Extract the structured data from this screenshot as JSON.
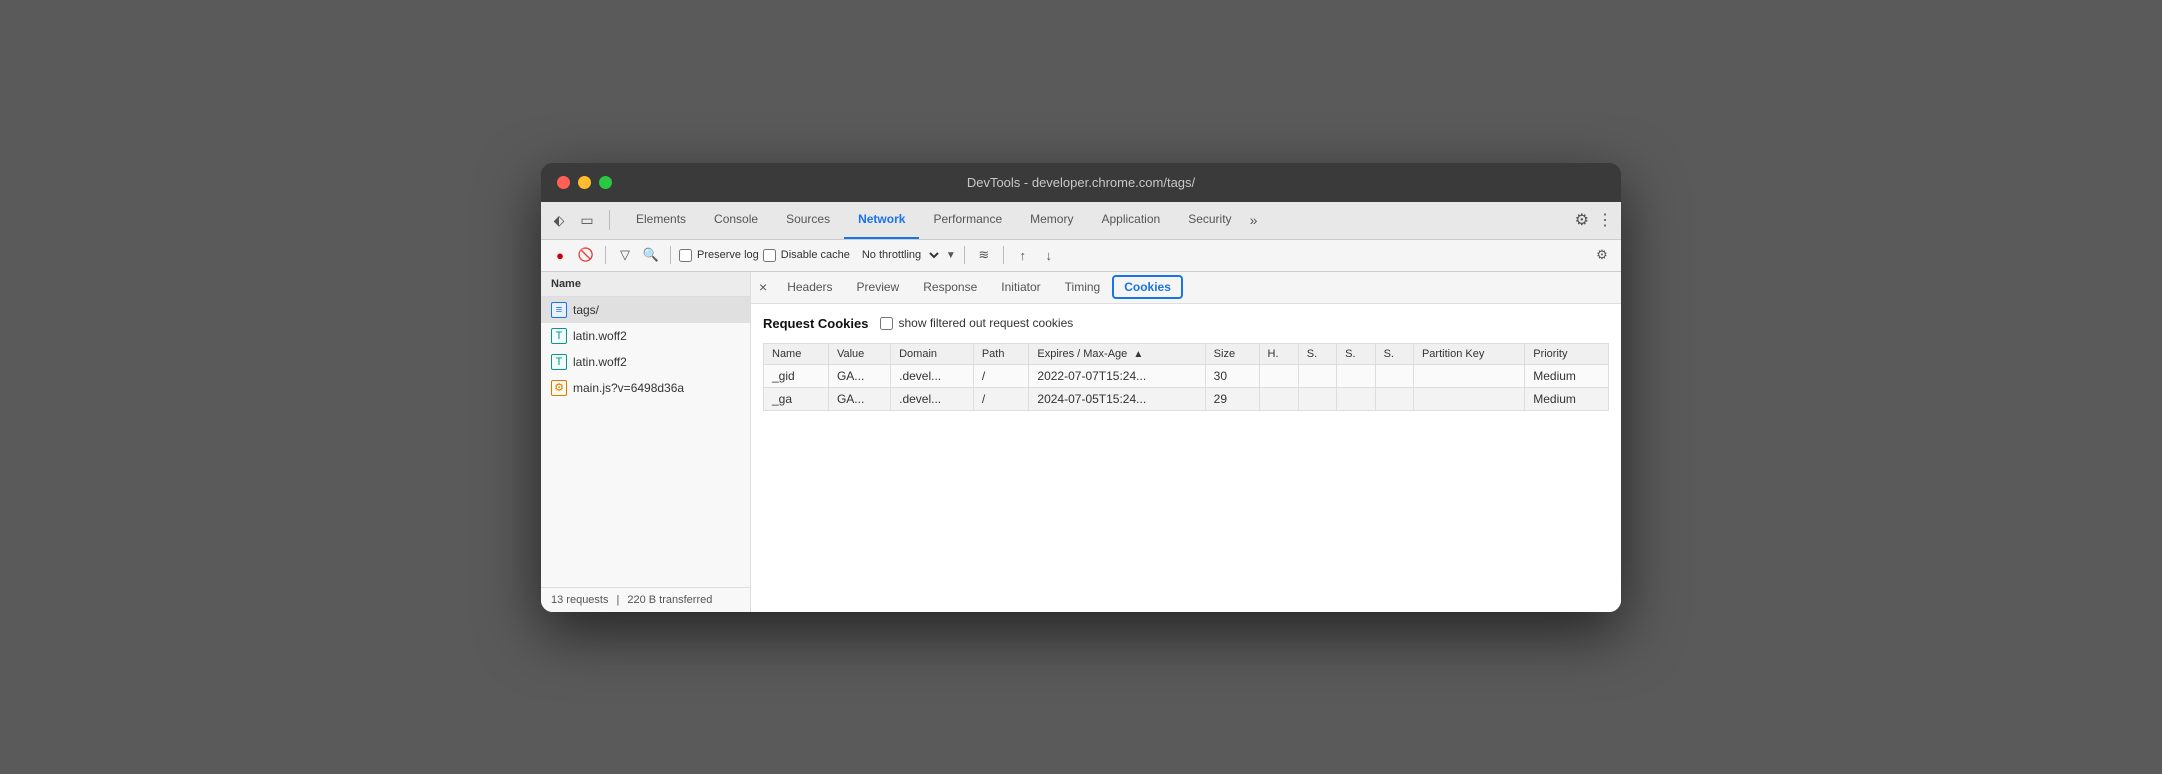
{
  "window": {
    "title": "DevTools - developer.chrome.com/tags/"
  },
  "tabs": {
    "items": [
      {
        "label": "Elements",
        "active": false
      },
      {
        "label": "Console",
        "active": false
      },
      {
        "label": "Sources",
        "active": false
      },
      {
        "label": "Network",
        "active": true
      },
      {
        "label": "Performance",
        "active": false
      },
      {
        "label": "Memory",
        "active": false
      },
      {
        "label": "Application",
        "active": false
      },
      {
        "label": "Security",
        "active": false
      }
    ],
    "more_label": "»",
    "settings_icon": "⚙",
    "dots_icon": "⋮"
  },
  "toolbar": {
    "record_icon": "●",
    "block_icon": "🚫",
    "filter_icon": "▽",
    "search_icon": "🔍",
    "preserve_log_label": "Preserve log",
    "disable_cache_label": "Disable cache",
    "throttling_label": "No throttling",
    "wifi_icon": "≋",
    "upload_icon": "↑",
    "download_icon": "↓",
    "settings_icon": "⚙"
  },
  "sidebar": {
    "header": "Name",
    "items": [
      {
        "name": "tags/",
        "icon_type": "blue",
        "icon_label": "≡",
        "selected": true
      },
      {
        "name": "latin.woff2",
        "icon_type": "teal",
        "icon_label": "T"
      },
      {
        "name": "latin.woff2",
        "icon_type": "teal",
        "icon_label": "T"
      },
      {
        "name": "main.js?v=6498d36a",
        "icon_type": "orange",
        "icon_label": "⚙"
      }
    ],
    "footer_requests": "13 requests",
    "footer_transferred": "220 B transferred"
  },
  "panel_tabs": {
    "close_icon": "×",
    "items": [
      {
        "label": "Headers",
        "active": false
      },
      {
        "label": "Preview",
        "active": false
      },
      {
        "label": "Response",
        "active": false
      },
      {
        "label": "Initiator",
        "active": false
      },
      {
        "label": "Timing",
        "active": false
      },
      {
        "label": "Cookies",
        "active": true
      }
    ]
  },
  "cookies_panel": {
    "title": "Request Cookies",
    "show_filtered_label": "show filtered out request cookies",
    "table": {
      "columns": [
        {
          "label": "Name",
          "sortable": false
        },
        {
          "label": "Value",
          "sortable": false
        },
        {
          "label": "Domain",
          "sortable": false
        },
        {
          "label": "Path",
          "sortable": false
        },
        {
          "label": "Expires / Max-Age",
          "sortable": true,
          "sort": "▲"
        },
        {
          "label": "Size",
          "sortable": false
        },
        {
          "label": "H.",
          "sortable": false
        },
        {
          "label": "S.",
          "sortable": false
        },
        {
          "label": "S.",
          "sortable": false
        },
        {
          "label": "S.",
          "sortable": false
        },
        {
          "label": "Partition Key",
          "sortable": false
        },
        {
          "label": "Priority",
          "sortable": false
        }
      ],
      "rows": [
        {
          "name": "_gid",
          "value": "GA...",
          "domain": ".devel...",
          "path": "/",
          "expires": "2022-07-07T15:24...",
          "size": "30",
          "h": "",
          "s1": "",
          "s2": "",
          "s3": "",
          "partition_key": "",
          "priority": "Medium"
        },
        {
          "name": "_ga",
          "value": "GA...",
          "domain": ".devel...",
          "path": "/",
          "expires": "2024-07-05T15:24...",
          "size": "29",
          "h": "",
          "s1": "",
          "s2": "",
          "s3": "",
          "partition_key": "",
          "priority": "Medium"
        }
      ]
    }
  }
}
